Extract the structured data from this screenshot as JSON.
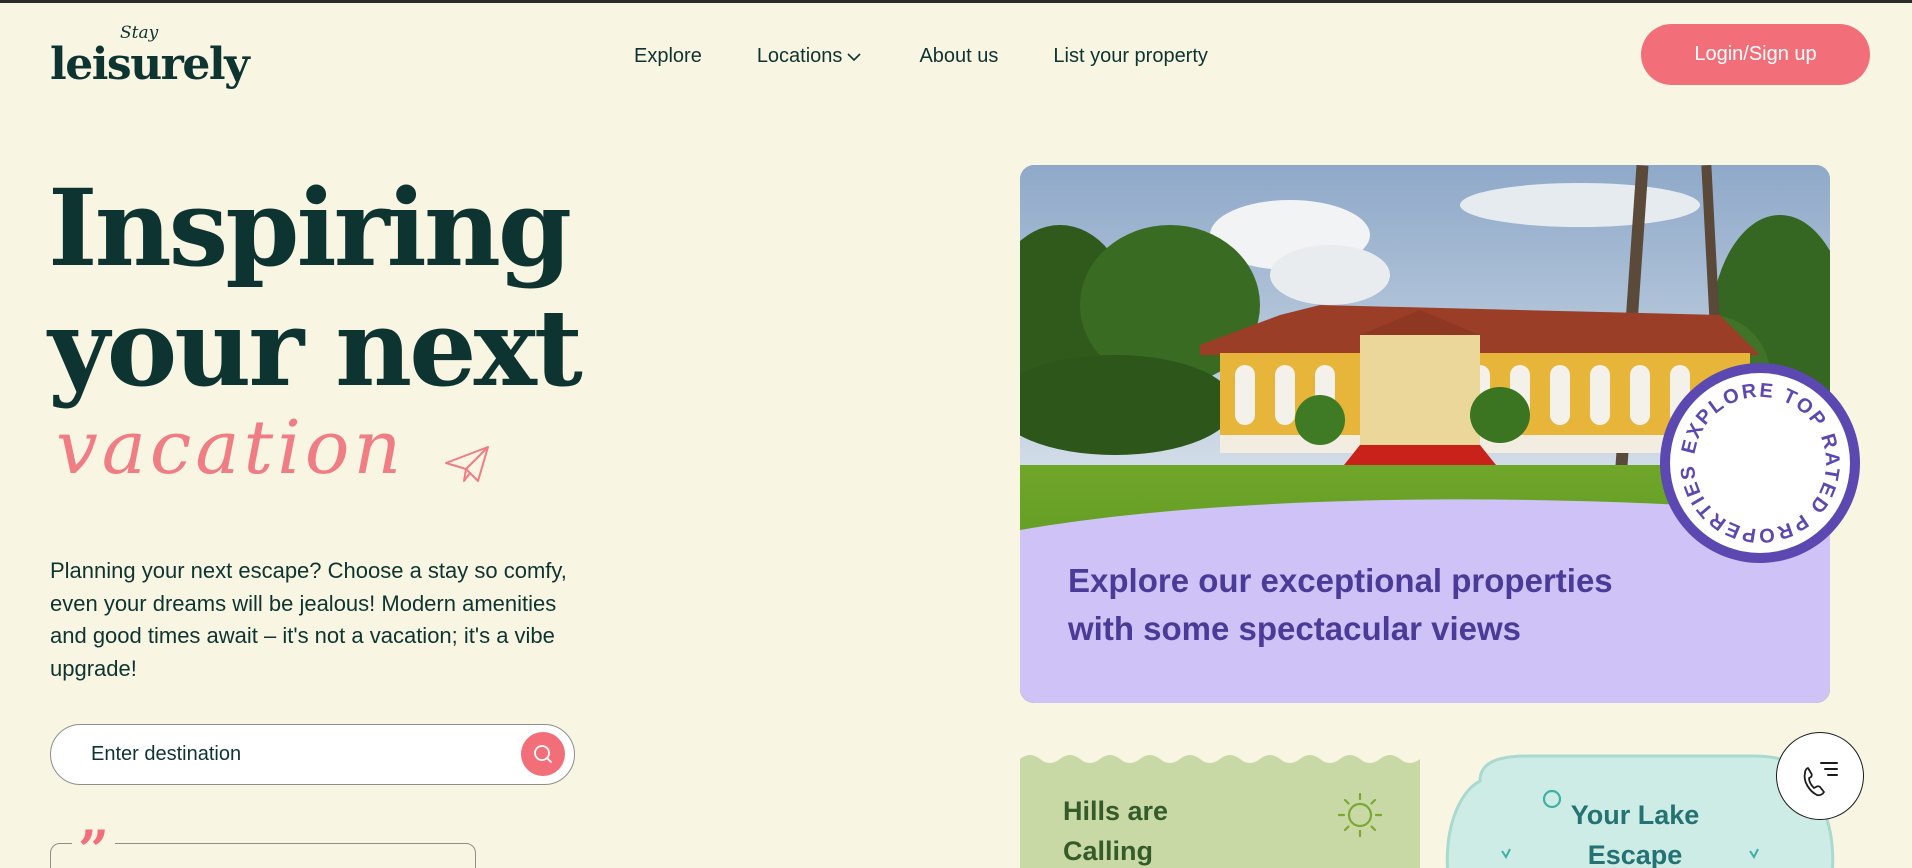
{
  "brand": {
    "script": "Stay",
    "name": "leisurely"
  },
  "nav": {
    "explore": "Explore",
    "locations": "Locations",
    "about": "About us",
    "list_property": "List your property"
  },
  "header": {
    "login_label": "Login/Sign up"
  },
  "hero": {
    "line1": "Inspiring",
    "line2": "your next",
    "script_word": "vacation",
    "intro": "Planning your next escape? Choose a stay so comfy, even your dreams will be jealous! Modern amenities and good times await – it's not a vacation; it's a vibe upgrade!",
    "search_placeholder": "Enter destination"
  },
  "feature": {
    "text": "Explore our exceptional properties with some spectacular views",
    "badge_text": "EXPLORE TOP RATED PROPERTIES"
  },
  "cards": {
    "hills": "Hills are Calling",
    "lake": "Your Lake Escape"
  },
  "icons": {
    "search": "search-icon",
    "chevron": "chevron-down-icon",
    "plane": "paper-plane-icon",
    "sun": "sun-icon",
    "phone_menu": "phone-menu-icon",
    "quote": "quote-icon"
  },
  "colors": {
    "background": "#f8f5e3",
    "primary_text": "#0e3431",
    "accent_pink": "#f26f7a",
    "lavender": "#cfc2f6",
    "purple": "#4b3b98",
    "hills_green": "#c8d9a6",
    "lake_teal": "#cdece6"
  }
}
